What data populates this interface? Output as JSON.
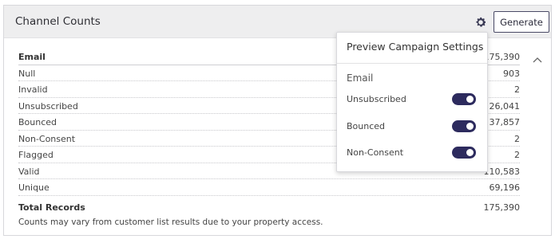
{
  "panel": {
    "title": "Channel Counts",
    "generate_label": "Generate"
  },
  "table": {
    "header": {
      "label": "Email",
      "value": "175,390"
    },
    "rows": [
      {
        "label": "Null",
        "value": "903"
      },
      {
        "label": "Invalid",
        "value": "2"
      },
      {
        "label": "Unsubscribed",
        "value": "26,041"
      },
      {
        "label": "Bounced",
        "value": "37,857"
      },
      {
        "label": "Non-Consent",
        "value": "2"
      },
      {
        "label": "Flagged",
        "value": "2"
      },
      {
        "label": "Valid",
        "value": "110,583"
      },
      {
        "label": "Unique",
        "value": "69,196"
      }
    ],
    "total": {
      "label": "Total Records",
      "value": "175,390"
    },
    "note": "Counts may vary from customer list results due to your property access."
  },
  "popover": {
    "title": "Preview Campaign Settings",
    "section": "Email",
    "toggles": [
      {
        "label": "Unsubscribed",
        "on": true
      },
      {
        "label": "Bounced",
        "on": true
      },
      {
        "label": "Non-Consent",
        "on": true
      }
    ]
  },
  "icons": {
    "settings": "gear-icon",
    "collapse": "chevron-up-icon"
  },
  "colors": {
    "toggle_on": "#2d2b5e",
    "header_bg": "#eeeeef"
  }
}
